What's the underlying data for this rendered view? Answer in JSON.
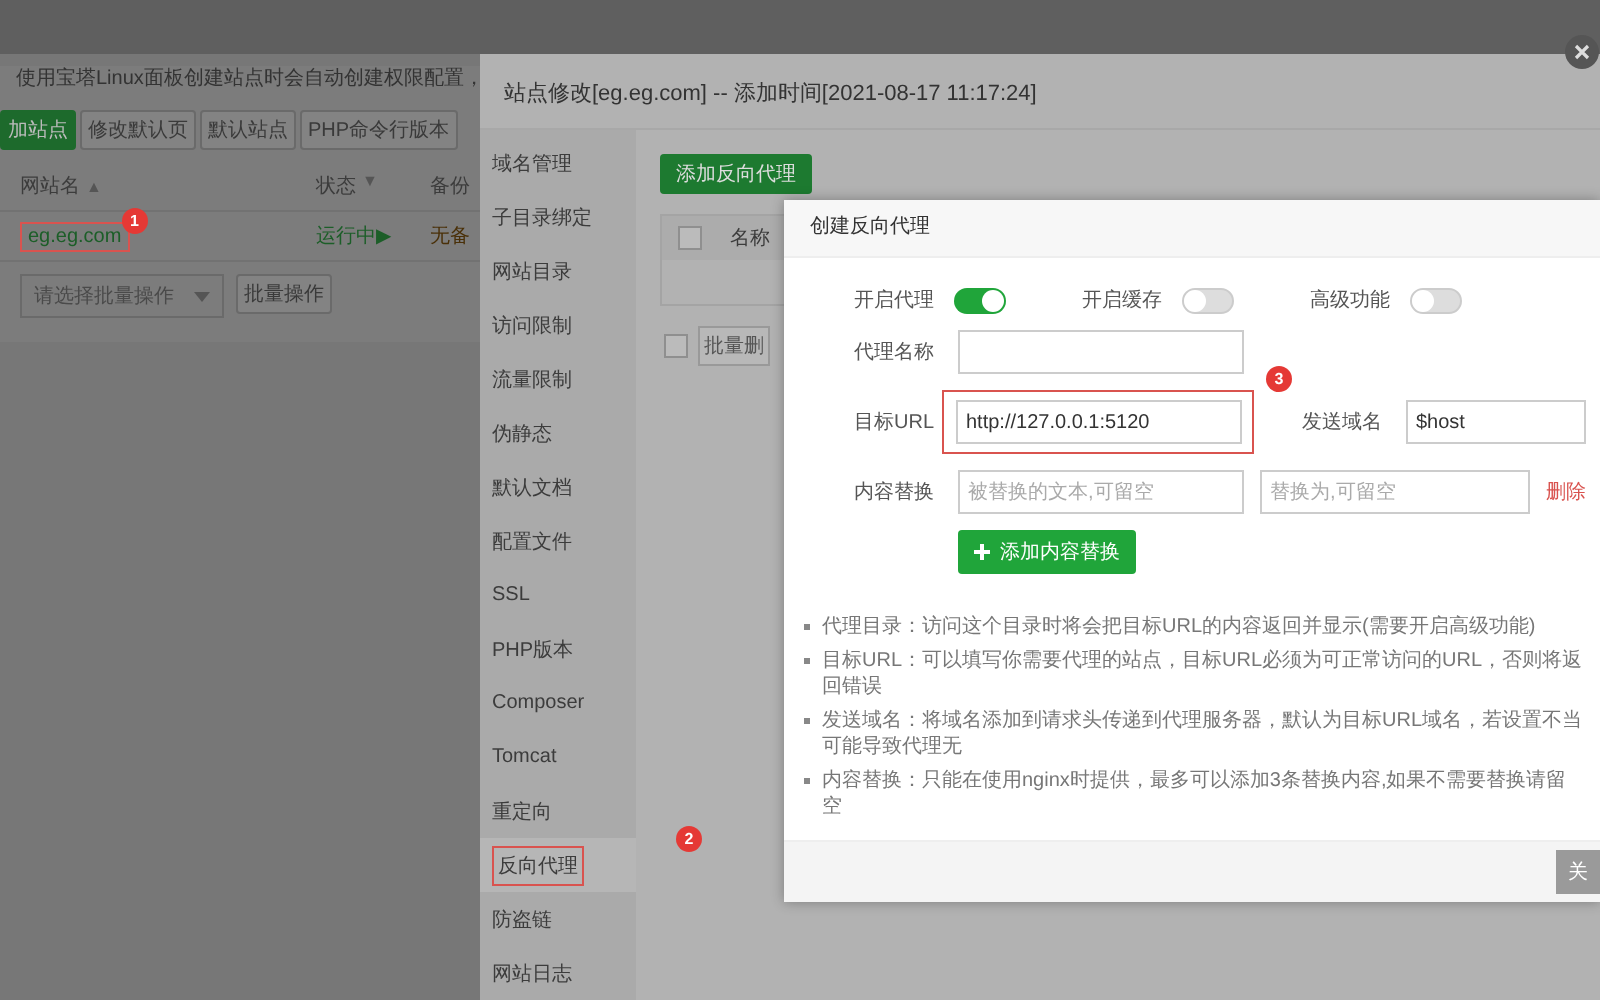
{
  "background_page": {
    "notice": "使用宝塔Linux面板创建站点时会自动创建权限配置，",
    "buttons": [
      {
        "label": "加站点",
        "kind": "primary"
      },
      {
        "label": "修改默认页",
        "kind": "default"
      },
      {
        "label": "默认站点",
        "kind": "default"
      },
      {
        "label": "PHP命令行版本",
        "kind": "default"
      }
    ],
    "table": {
      "columns": [
        {
          "label": "网站名",
          "sort": "▲"
        },
        {
          "label": "状态",
          "sort": "▼"
        },
        {
          "label": "备份"
        }
      ],
      "rows": [
        {
          "site": "eg.eg.com",
          "status": "运行中▶",
          "backup": "无备",
          "highlighted": true,
          "badge": "1"
        }
      ]
    },
    "batch_select": "请选择批量操作",
    "batch_button": "批量操作"
  },
  "site_dialog": {
    "title": "站点修改[eg.eg.com] -- 添加时间[2021-08-17 11:17:24]",
    "sidebar": [
      {
        "label": "域名管理",
        "selected": false,
        "highlighted": false
      },
      {
        "label": "子目录绑定",
        "selected": false,
        "highlighted": false
      },
      {
        "label": "网站目录",
        "selected": false,
        "highlighted": false
      },
      {
        "label": "访问限制",
        "selected": false,
        "highlighted": false
      },
      {
        "label": "流量限制",
        "selected": false,
        "highlighted": false
      },
      {
        "label": "伪静态",
        "selected": false,
        "highlighted": false
      },
      {
        "label": "默认文档",
        "selected": false,
        "highlighted": false
      },
      {
        "label": "配置文件",
        "selected": false,
        "highlighted": false
      },
      {
        "label": "SSL",
        "selected": false,
        "highlighted": false
      },
      {
        "label": "PHP版本",
        "selected": false,
        "highlighted": false
      },
      {
        "label": "Composer",
        "selected": false,
        "highlighted": false
      },
      {
        "label": "Tomcat",
        "selected": false,
        "highlighted": false
      },
      {
        "label": "重定向",
        "selected": false,
        "highlighted": false
      },
      {
        "label": "反向代理",
        "selected": true,
        "highlighted": true,
        "badge": "2"
      },
      {
        "label": "防盗链",
        "selected": false,
        "highlighted": false
      },
      {
        "label": "网站日志",
        "selected": false,
        "highlighted": false
      }
    ],
    "add_button": "添加反向代理",
    "table": {
      "columns": [
        "名称"
      ],
      "select_all_checked": false
    },
    "batch_checked": false,
    "batch_button": "批量删"
  },
  "proxy_dialog": {
    "title": "创建反向代理",
    "toggles": [
      {
        "label": "开启代理",
        "on": true
      },
      {
        "label": "开启缓存",
        "on": false
      },
      {
        "label": "高级功能",
        "on": false
      }
    ],
    "proxy_name": {
      "label": "代理名称"
    },
    "target_url": {
      "label": "目标URL",
      "value": "http://127.0.0.1:5120",
      "highlighted": true,
      "badge": "3"
    },
    "send_domain": {
      "label": "发送域名",
      "value": "$host"
    },
    "replace": {
      "label": "内容替换",
      "from_placeholder": "被替换的文本,可留空",
      "to_placeholder": "替换为,可留空",
      "delete": "删除"
    },
    "add_replace_button": "添加内容替换",
    "notes": [
      "代理目录：访问这个目录时将会把目标URL的内容返回并显示(需要开启高级功能)",
      "目标URL：可以填写你需要代理的站点，目标URL必须为可正常访问的URL，否则将返回错误",
      "发送域名：将域名添加到请求头传递到代理服务器，默认为目标URL域名，若设置不当可能导致代理无",
      "内容替换：只能在使用nginx时提供，最多可以添加3条替换内容,如果不需要替换请留空"
    ],
    "close_button": "关"
  }
}
